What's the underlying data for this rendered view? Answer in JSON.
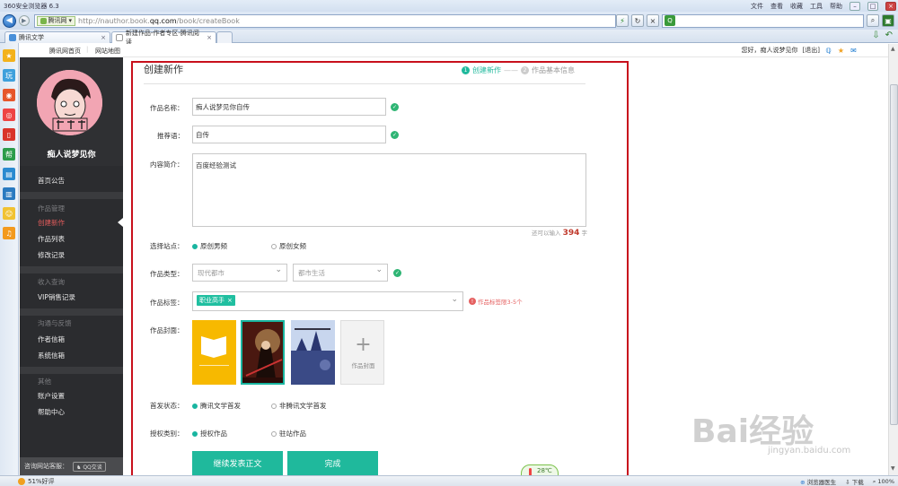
{
  "browser": {
    "title": "360安全浏览器 6.3",
    "menu": [
      "文件",
      "查看",
      "收藏",
      "工具",
      "帮助"
    ],
    "address": {
      "tag_label": "腾讯网",
      "url_prefix": "http://nauthor.book.",
      "url_host": "qq.com",
      "url_path": "/book/createBook"
    },
    "tabs": [
      {
        "label": "腾讯文学",
        "close": "×"
      },
      {
        "label": "新建作品-作者专区-腾讯阅读",
        "close": "×"
      }
    ],
    "status": {
      "left": "51%好评",
      "right": [
        "浏览器医生",
        "下载",
        "100%"
      ],
      "weather": "28℃"
    }
  },
  "page": {
    "topnav": {
      "home": "腾讯网首页",
      "sitemap": "网站地图",
      "greeting": "您好，痴人说梦见你",
      "logout": "[退出]"
    },
    "sidebar": {
      "username": "痴人说梦见你",
      "sections": [
        {
          "items": [
            "首页公告"
          ]
        },
        {
          "header": "作品管理",
          "items": [
            "创建新作",
            "作品列表",
            "修改记录"
          ]
        },
        {
          "header": "收入查询",
          "items": [
            "VIP销售记录"
          ]
        },
        {
          "header": "沟通与反馈",
          "items": [
            "作者信箱",
            "系统信箱"
          ]
        },
        {
          "header": "其他",
          "items": [
            "账户设置",
            "帮助中心"
          ]
        }
      ],
      "consult_label": "咨询网站客服：",
      "consult_btn": "QQ交谈"
    },
    "form": {
      "title": "创建新作",
      "step1": "创建新作",
      "step_sep": "——",
      "step2": "作品基本信息",
      "step1_num": "1",
      "step2_num": "2",
      "name_label": "作品名称：",
      "name_value": "痴人说梦见你自传",
      "slogan_label": "推荐语：",
      "slogan_value": "自传",
      "intro_label": "内容简介：",
      "intro_value": "百度经验测试",
      "count_prefix": "还可以输入",
      "count_value": "394",
      "count_suffix": "字",
      "site_label": "选择站点：",
      "site_opt1": "原创男频",
      "site_opt2": "原创女频",
      "type_label": "作品类型：",
      "type_sel1": "现代都市",
      "type_sel2": "都市生活",
      "tags_label": "作品标签：",
      "tag_chip": "职业高手",
      "tags_hint": "作品标签限3-5个",
      "cover_label": "作品封面：",
      "cover_add": "作品封面",
      "cover_add_plus": "+",
      "first_label": "首发状态：",
      "first_opt1": "腾讯文学首发",
      "first_opt2": "非腾讯文学首发",
      "auth_label": "授权类别：",
      "auth_opt1": "授权作品",
      "auth_opt2": "驻站作品",
      "btn_continue": "继续发表正文",
      "btn_done": "完成"
    }
  },
  "watermark": {
    "brand": "Bai经验",
    "domain": "jingyan.baidu.com"
  },
  "colors": {
    "accent": "#1fb99c",
    "check": "#2fb574",
    "highlight_box": "#c8101c",
    "nav_bg": "#2f3033",
    "active_nav": "#e35c5c"
  }
}
